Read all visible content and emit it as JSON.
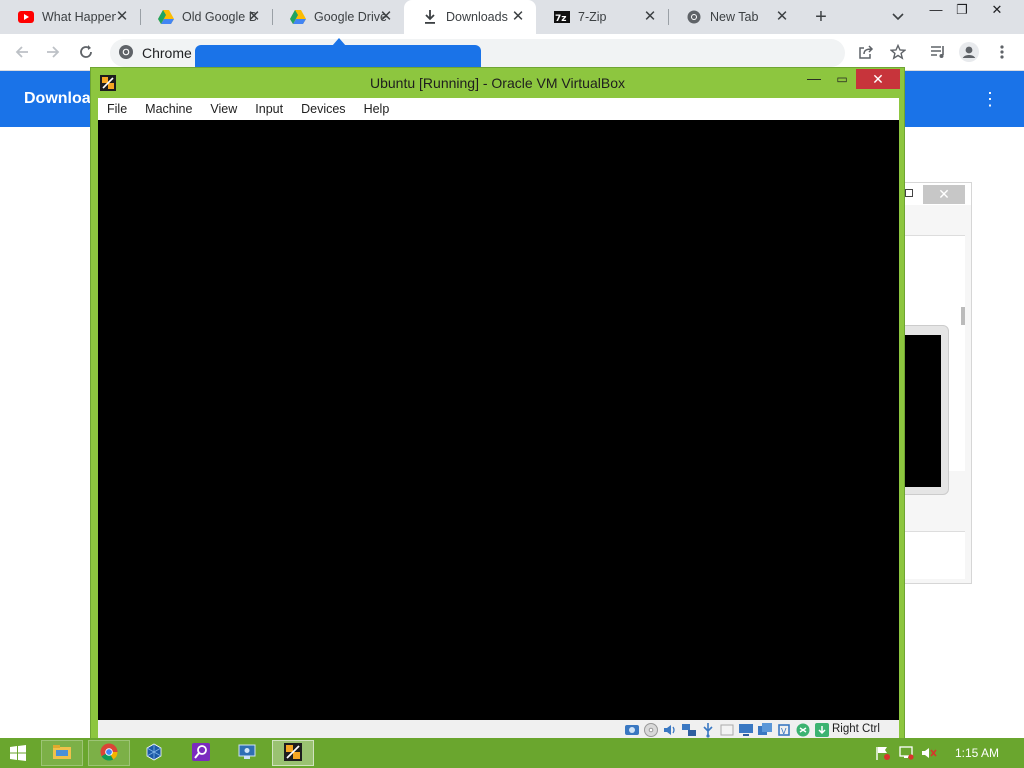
{
  "browser": {
    "tabs": [
      {
        "title": "What Happened",
        "favicon": "youtube-icon",
        "active": false
      },
      {
        "title": "Old Google Drive",
        "favicon": "google-drive-icon",
        "active": false
      },
      {
        "title": "Google Drive",
        "favicon": "google-drive-icon",
        "active": false
      },
      {
        "title": "Downloads",
        "favicon": "download-icon",
        "active": true
      },
      {
        "title": "7-Zip",
        "favicon": "7zip-icon",
        "active": false
      },
      {
        "title": "New Tab",
        "favicon": "chrome-icon",
        "active": false
      }
    ],
    "close_glyph": "✕",
    "new_tab_glyph": "+",
    "omnibox_text": "Chrome",
    "page_title": "Downloads",
    "colors": {
      "accent": "#1a73e8",
      "tabstrip": "#dee1e6"
    }
  },
  "vbox": {
    "title": "Ubuntu [Running] - Oracle VM VirtualBox",
    "menu": [
      "File",
      "Machine",
      "View",
      "Input",
      "Devices",
      "Help"
    ],
    "host_key": "Right Ctrl",
    "status_icons": [
      "hard-disk-icon",
      "optical-disk-icon",
      "audio-icon",
      "network-icon",
      "usb-icon",
      "shared-folder-icon",
      "display-icon",
      "video-capture-icon",
      "cpu-icon",
      "mouse-integration-icon",
      "keyboard-capture-icon"
    ],
    "colors": {
      "frame": "#8dc63f",
      "close": "#c7343b",
      "screen": "#000000"
    }
  },
  "taskbar": {
    "clock": "1:15 AM",
    "apps": [
      "file-explorer-icon",
      "chrome-icon",
      "virtualbox-icon",
      "search-app-icon",
      "remote-desktop-icon",
      "vm-running-icon"
    ],
    "tray": [
      "flag-icon",
      "network-icon",
      "volume-muted-icon"
    ],
    "color": "#6aa62e"
  }
}
